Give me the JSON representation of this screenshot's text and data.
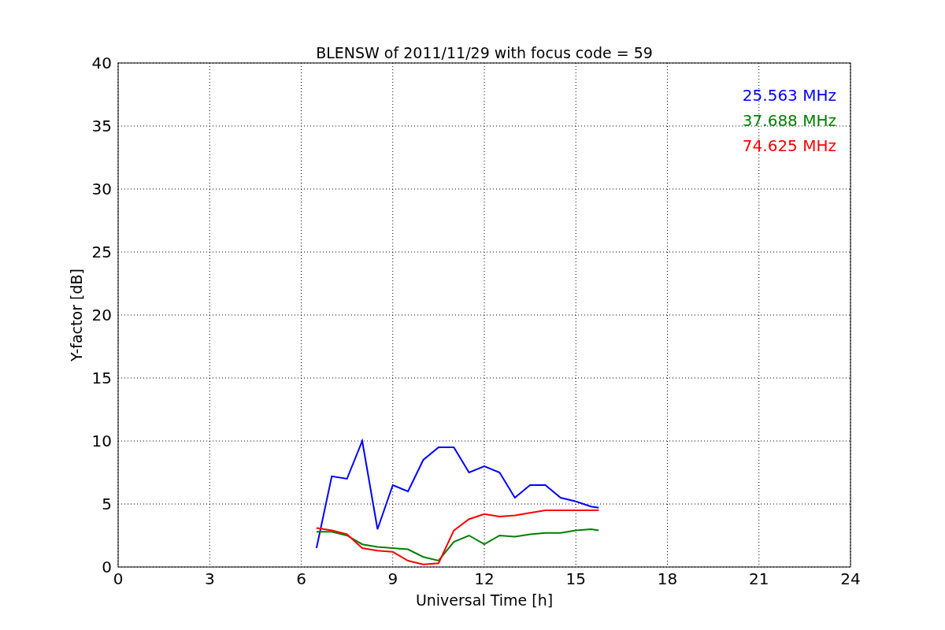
{
  "figure": {
    "chart_data": {
      "type": "line",
      "title": "BLENSW of 2011/11/29 with focus code = 59",
      "xlabel": "Universal Time [h]",
      "ylabel": "Y-factor [dB]",
      "x": [
        6.5,
        7,
        7.5,
        8,
        8.5,
        9,
        9.5,
        10,
        10.5,
        11,
        11.5,
        12,
        12.5,
        13,
        13.5,
        14,
        14.5,
        15,
        15.5,
        15.75
      ],
      "series": [
        {
          "name": "25.563 MHz",
          "color": "#0000ff",
          "values": [
            1.5,
            7.2,
            7,
            10,
            3,
            6.5,
            6,
            8.5,
            9.5,
            9.5,
            7.5,
            8,
            7.5,
            5.5,
            6.5,
            6.5,
            5.5,
            5.2,
            4.8,
            4.7
          ]
        },
        {
          "name": "37.688 MHz",
          "color": "#008000",
          "values": [
            2.8,
            2.8,
            2.5,
            1.8,
            1.6,
            1.5,
            1.4,
            0.8,
            0.5,
            2,
            2.5,
            1.8,
            2.5,
            2.4,
            2.6,
            2.7,
            2.7,
            2.9,
            3,
            2.9
          ]
        },
        {
          "name": "74.625 MHz",
          "color": "#ff0000",
          "values": [
            3.1,
            2.9,
            2.6,
            1.5,
            1.3,
            1.2,
            0.5,
            0.2,
            0.3,
            2.9,
            3.8,
            4.2,
            4,
            4.1,
            4.3,
            4.5,
            4.5,
            4.5,
            4.5,
            4.5
          ]
        }
      ],
      "xlim": [
        0,
        24
      ],
      "ylim": [
        0,
        40
      ],
      "xticks": [
        0,
        3,
        6,
        9,
        12,
        15,
        18,
        21,
        24
      ],
      "yticks": [
        0,
        5,
        10,
        15,
        20,
        25,
        30,
        35,
        40
      ],
      "grid": true
    }
  }
}
